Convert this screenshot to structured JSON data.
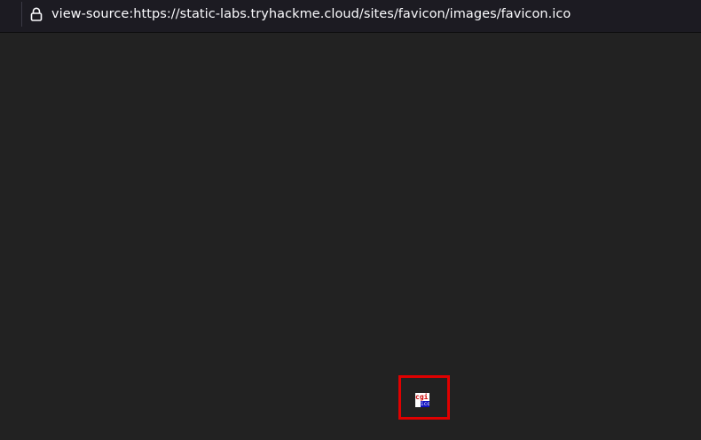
{
  "browser": {
    "address_bar": {
      "url": "view-source:https://static-labs.tryhackme.cloud/sites/favicon/images/favicon.ico",
      "lock_icon": "lock-icon"
    }
  },
  "page": {
    "favicon_image": {
      "top_text": "cgi",
      "bottom_text": "ico"
    },
    "highlight_color": "#e00000"
  }
}
